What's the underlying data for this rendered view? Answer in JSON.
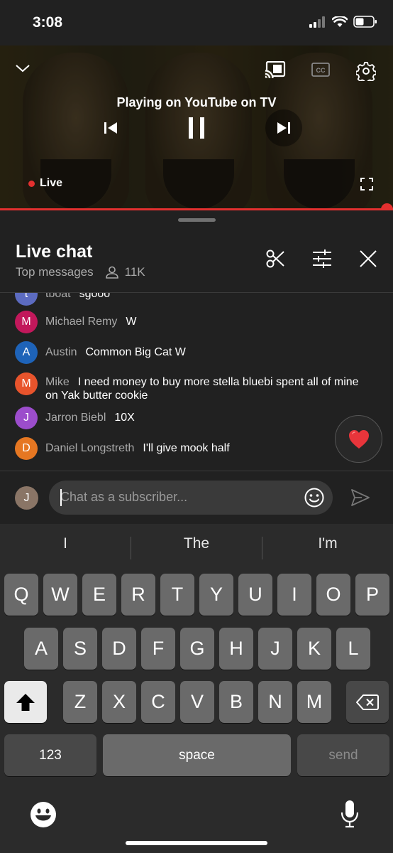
{
  "status_bar": {
    "time": "3:08",
    "icons": [
      "signal-icon",
      "wifi-icon",
      "battery-icon"
    ]
  },
  "video": {
    "casting_label": "Playing on YouTube on TV",
    "live_label": "Live",
    "icons": [
      "chevron-down-icon",
      "cast-icon",
      "cc-icon",
      "settings-gear-icon",
      "previous-icon",
      "pause-icon",
      "next-icon",
      "fullscreen-icon"
    ],
    "progress_fraction": 1.0,
    "accent_color": "#e3302f"
  },
  "chat": {
    "title": "Live chat",
    "mode": "Top messages",
    "viewer_count": "11K",
    "actions": [
      "scissors-icon",
      "filter-sliders-icon",
      "close-icon"
    ],
    "messages": [
      {
        "initial": "t",
        "author": "tboat",
        "text": "sgooo",
        "color": "#5c6bc0"
      },
      {
        "initial": "M",
        "author": "Michael Remy",
        "text": "W",
        "color": "#c2185b"
      },
      {
        "initial": "A",
        "author": "Austin",
        "text": "Common Big Cat W",
        "color": "#1e63b8"
      },
      {
        "initial": "M",
        "author": "Mike",
        "text": "I need money to buy more stella bluebi spent all of mine on Yak butter cookie",
        "color": "#e8542c"
      },
      {
        "initial": "J",
        "author": "Jarron Biebl",
        "text": "10X",
        "color": "#9c4dcc"
      },
      {
        "initial": "D",
        "author": "Daniel Longstreth",
        "text": "I'll give mook half",
        "color": "#e67722"
      }
    ],
    "reaction_icon": "heart-icon"
  },
  "input": {
    "avatar_initial": "J",
    "placeholder": "Chat as a subscriber...",
    "icons": [
      "emoji-icon",
      "send-icon"
    ]
  },
  "keyboard": {
    "suggestions": [
      "I",
      "The",
      "I'm"
    ],
    "row1": [
      "Q",
      "W",
      "E",
      "R",
      "T",
      "Y",
      "U",
      "I",
      "O",
      "P"
    ],
    "row2": [
      "A",
      "S",
      "D",
      "F",
      "G",
      "H",
      "J",
      "K",
      "L"
    ],
    "row3": [
      "Z",
      "X",
      "C",
      "V",
      "B",
      "N",
      "M"
    ],
    "numbers_label": "123",
    "space_label": "space",
    "send_label": "send",
    "icons": [
      "shift-icon",
      "backspace-icon",
      "emoji-keyboard-icon",
      "microphone-icon"
    ]
  }
}
